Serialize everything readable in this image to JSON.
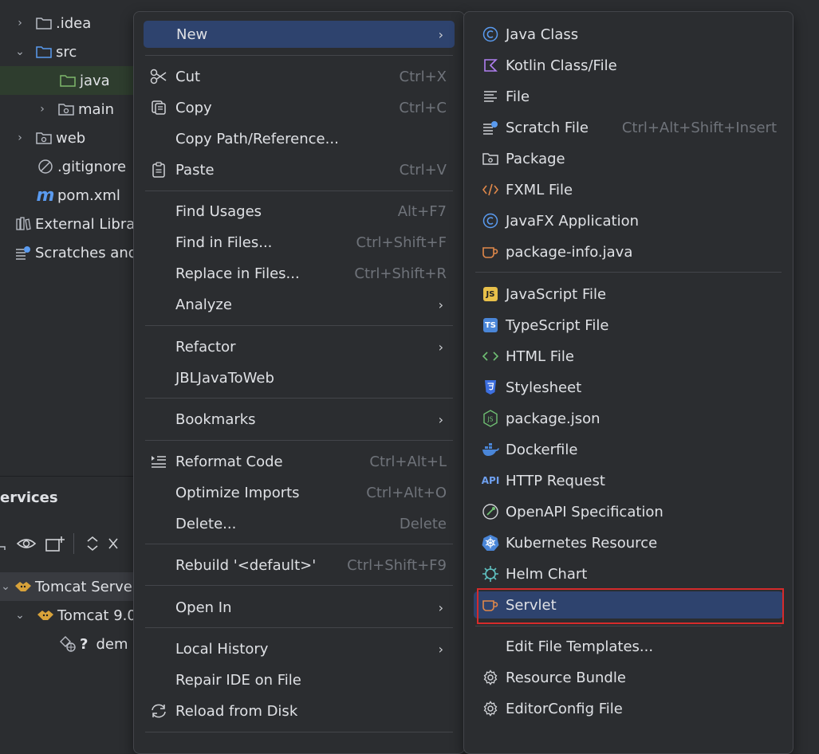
{
  "project_tree": {
    "items": [
      {
        "label": ".idea"
      },
      {
        "label": "src"
      },
      {
        "label": "java"
      },
      {
        "label": "main"
      },
      {
        "label": "web"
      },
      {
        "label": ".gitignore"
      },
      {
        "label": "pom.xml"
      },
      {
        "label": "External Librar"
      },
      {
        "label": "Scratches and"
      }
    ]
  },
  "services": {
    "title": "ervices",
    "items": [
      {
        "label": "Tomcat Server"
      },
      {
        "label": "Tomcat 9.0"
      },
      {
        "label": "dem"
      }
    ],
    "unknown_marker": "?"
  },
  "context_menu": {
    "items": [
      {
        "label": "New"
      },
      {
        "label": "Cut",
        "shortcut": "Ctrl+X"
      },
      {
        "label": "Copy",
        "shortcut": "Ctrl+C"
      },
      {
        "label": "Copy Path/Reference..."
      },
      {
        "label": "Paste",
        "shortcut": "Ctrl+V"
      },
      {
        "label": "Find Usages",
        "shortcut": "Alt+F7"
      },
      {
        "label": "Find in Files...",
        "shortcut": "Ctrl+Shift+F"
      },
      {
        "label": "Replace in Files...",
        "shortcut": "Ctrl+Shift+R"
      },
      {
        "label": "Analyze"
      },
      {
        "label": "Refactor"
      },
      {
        "label": "JBLJavaToWeb"
      },
      {
        "label": "Bookmarks"
      },
      {
        "label": "Reformat Code",
        "shortcut": "Ctrl+Alt+L"
      },
      {
        "label": "Optimize Imports",
        "shortcut": "Ctrl+Alt+O"
      },
      {
        "label": "Delete...",
        "shortcut": "Delete"
      },
      {
        "label": "Rebuild '<default>'",
        "shortcut": "Ctrl+Shift+F9"
      },
      {
        "label": "Open In"
      },
      {
        "label": "Local History"
      },
      {
        "label": "Repair IDE on File"
      },
      {
        "label": "Reload from Disk"
      }
    ]
  },
  "new_submenu": {
    "items": [
      {
        "label": "Java Class"
      },
      {
        "label": "Kotlin Class/File"
      },
      {
        "label": "File"
      },
      {
        "label": "Scratch File",
        "shortcut": "Ctrl+Alt+Shift+Insert"
      },
      {
        "label": "Package"
      },
      {
        "label": "FXML File"
      },
      {
        "label": "JavaFX Application"
      },
      {
        "label": "package-info.java"
      },
      {
        "label": "JavaScript File"
      },
      {
        "label": "TypeScript File"
      },
      {
        "label": "HTML File"
      },
      {
        "label": "Stylesheet"
      },
      {
        "label": "package.json"
      },
      {
        "label": "Dockerfile"
      },
      {
        "label": "HTTP Request"
      },
      {
        "label": "OpenAPI Specification"
      },
      {
        "label": "Kubernetes Resource"
      },
      {
        "label": "Helm Chart"
      },
      {
        "label": "Servlet"
      },
      {
        "label": "Edit File Templates..."
      },
      {
        "label": "Resource Bundle"
      },
      {
        "label": "EditorConfig File"
      }
    ],
    "badges": {
      "js": "JS",
      "ts": "TS",
      "api": "API"
    }
  },
  "colors": {
    "menu_bg": "#2b2d30",
    "highlight": "#2e436e",
    "focus_outline": "#d52b2b",
    "shortcut": "#6f737a"
  }
}
